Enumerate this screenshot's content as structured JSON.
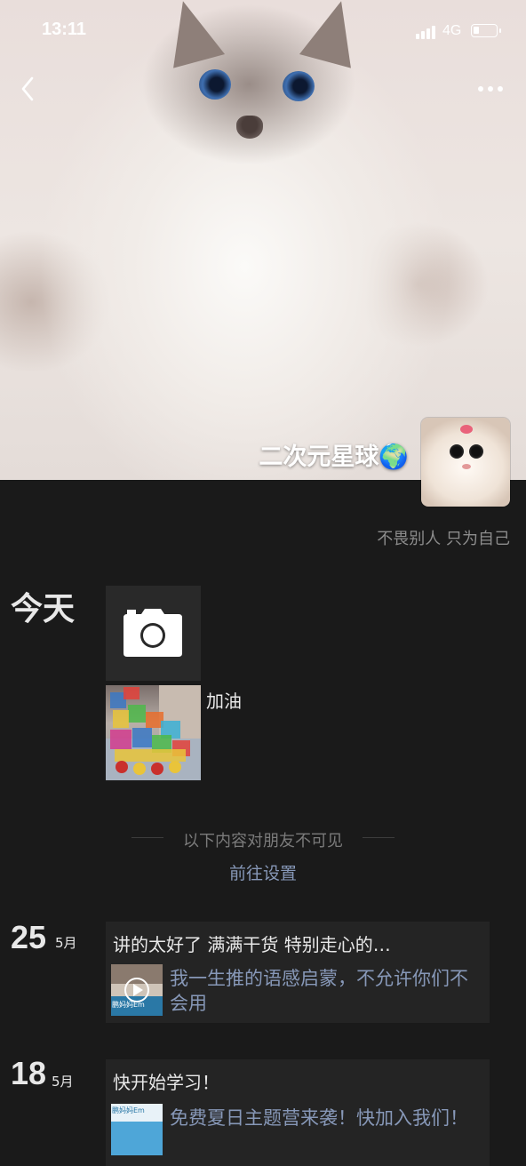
{
  "status": {
    "time": "13:11",
    "network": "4G"
  },
  "profile": {
    "nickname": "二次元星球🌍",
    "signature": "不畏别人 只为自己"
  },
  "today": {
    "label": "今天",
    "photo_caption": "加油"
  },
  "privacy": {
    "notice": "以下内容对朋友不可见",
    "settings_link": "前往设置"
  },
  "posts": [
    {
      "day": "25",
      "month": "5月",
      "text": "讲的太好了 满满干货 特别走心的…",
      "share_title": "我一生推的语感启蒙，不允许你们不会用",
      "share_thumb_text": "鹏妈妈Em"
    },
    {
      "day": "18",
      "month": "5月",
      "text": "快开始学习！",
      "share_title": "免费夏日主题营来袭！快加入我们！",
      "share_thumb_text": "鹏妈妈Em"
    }
  ],
  "colors": {
    "background": "#1a1a1a",
    "link": "#8798b8",
    "card": "#242424"
  }
}
